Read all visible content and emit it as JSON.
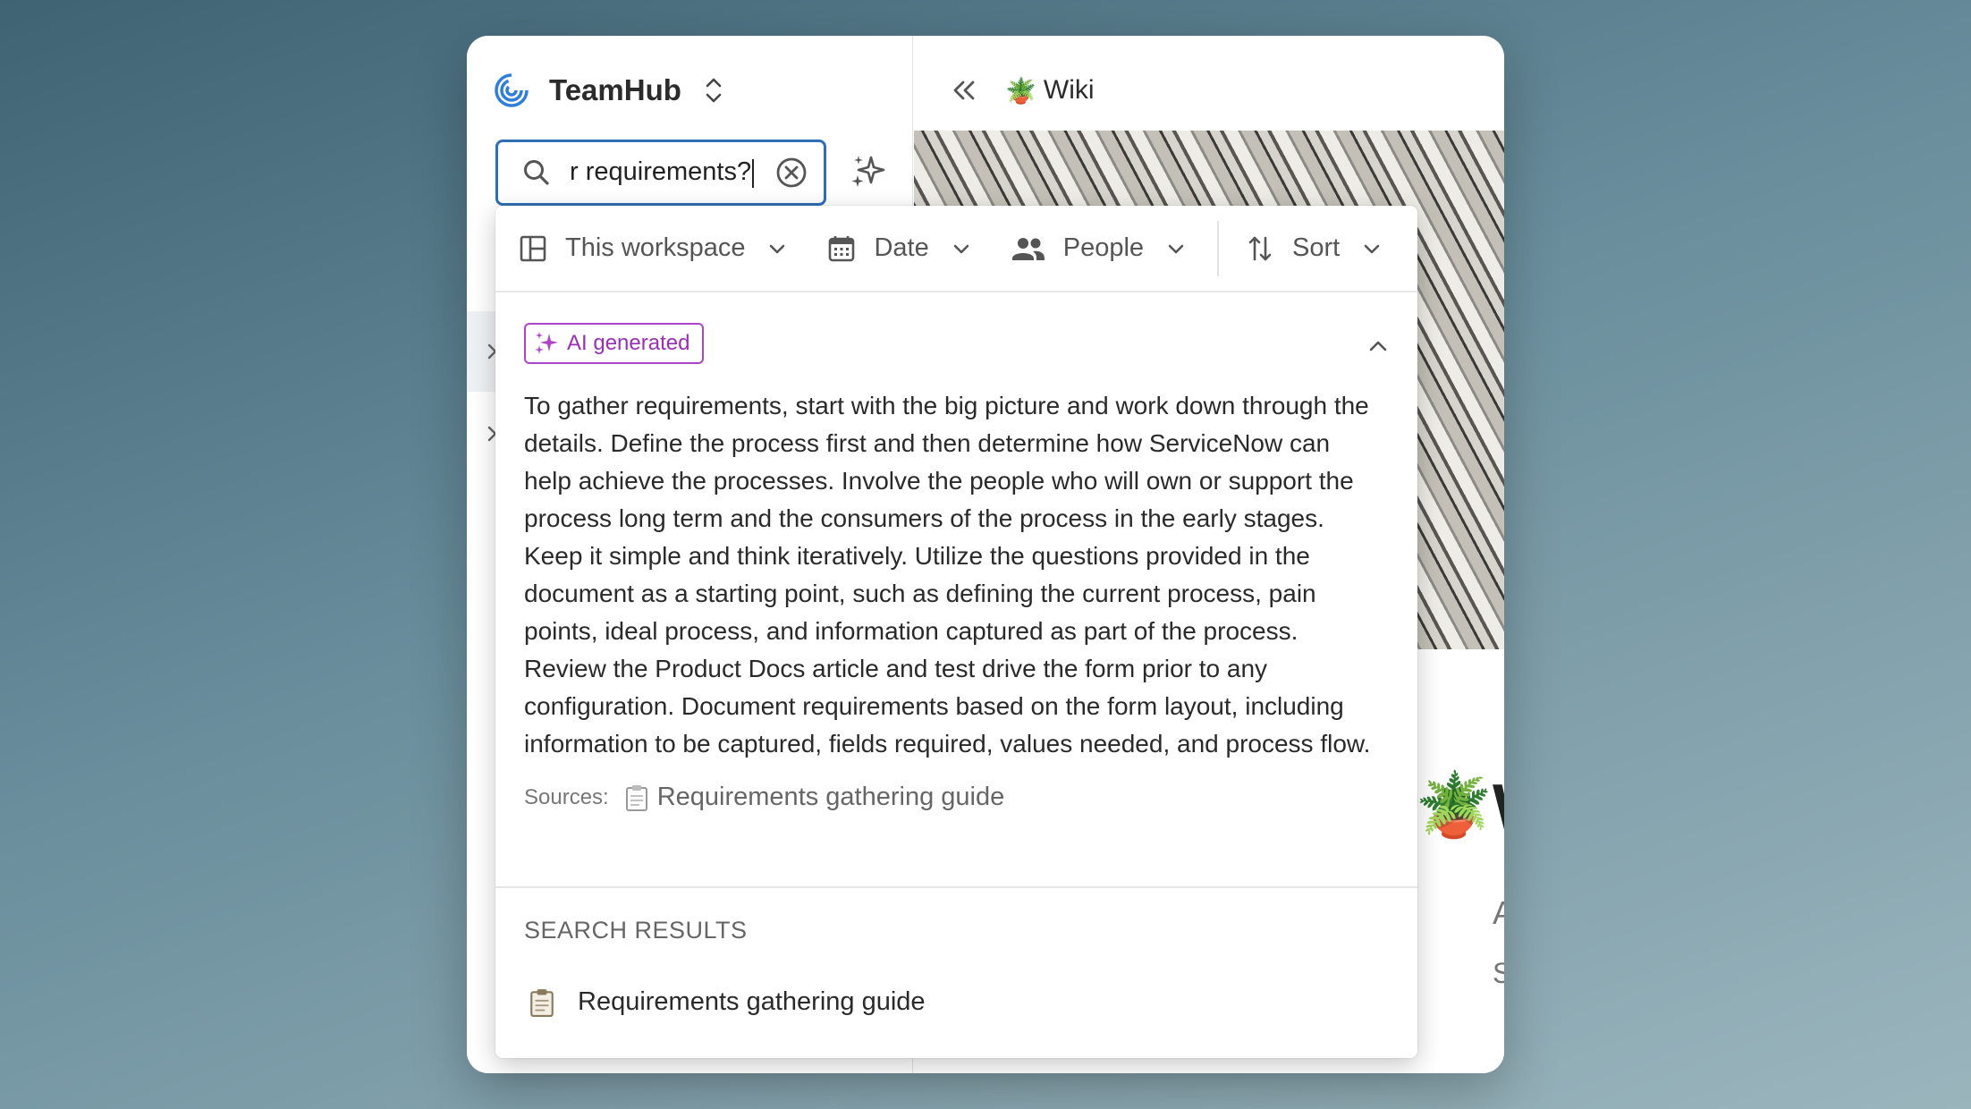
{
  "workspace": {
    "name": "TeamHub"
  },
  "search": {
    "query_visible": "r requirements?"
  },
  "breadcrumb": {
    "title": "Wiki",
    "emoji": "🪴"
  },
  "filters": [
    {
      "label": "This workspace",
      "icon": "layout-icon"
    },
    {
      "label": "Date",
      "icon": "calendar-icon"
    },
    {
      "label": "People",
      "icon": "people-icon"
    },
    {
      "label": "Sort",
      "icon": "sort-icon"
    }
  ],
  "ai": {
    "badge": "AI generated",
    "answer": "To gather requirements, start with the big picture and work down through the details. Define the process first and then determine how ServiceNow can help achieve the processes. Involve the people who will own or support the process long term and the consumers of the process in the early stages. Keep it simple and think iteratively. Utilize the questions provided in the document as a starting point, such as defining the current process, pain points, ideal process, and information captured as part of the process. Review the Product Docs article and test drive the form prior to any configuration. Document requirements based on the form layout, including information to be captured, fields required, values needed, and process flow.",
    "sources_label": "Sources:",
    "source_title": "Requirements gathering guide"
  },
  "results": {
    "heading": "SEARCH RESULTS",
    "items": [
      {
        "title": "Requirements gathering guide"
      }
    ]
  },
  "page": {
    "emoji": "🪴",
    "title_fragment": "W",
    "line1_fragment": "A",
    "line2_fragment": "S"
  },
  "colors": {
    "accent": "#2f6fb5",
    "ai_purple": "#9a2fb5"
  }
}
